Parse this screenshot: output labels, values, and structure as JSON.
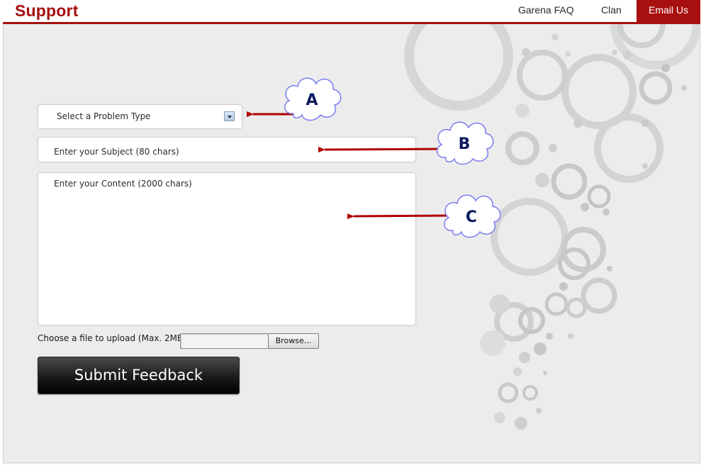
{
  "header": {
    "brand": "Support",
    "nav": [
      {
        "label": "Garena FAQ"
      },
      {
        "label": "Clan"
      },
      {
        "label": "Email Us",
        "active": true
      }
    ]
  },
  "form": {
    "problem_type_select": {
      "value": "Select a Problem Type"
    },
    "subject": {
      "placeholder": "Enter your Subject (80 chars)"
    },
    "content": {
      "placeholder": "Enter your Content (2000 chars)"
    },
    "upload": {
      "label": "Choose a file to upload (Max. 2MB)",
      "browse_label": "Browse..."
    },
    "submit_label": "Submit Feedback"
  },
  "annotations": {
    "callouts": [
      {
        "letter": "A",
        "target": "problem-type-select"
      },
      {
        "letter": "B",
        "target": "subject-input"
      },
      {
        "letter": "C",
        "target": "content-input"
      }
    ]
  },
  "colors": {
    "brand_red": "#a80f0f",
    "callout_arrow": "#b00000",
    "callout_border": "#7b7bf0",
    "callout_text": "#0c1a5e",
    "panel_bg": "#ececec"
  },
  "icons": {
    "select_arrow": "chevron-down-icon",
    "callout": "cloud-callout-icon"
  }
}
